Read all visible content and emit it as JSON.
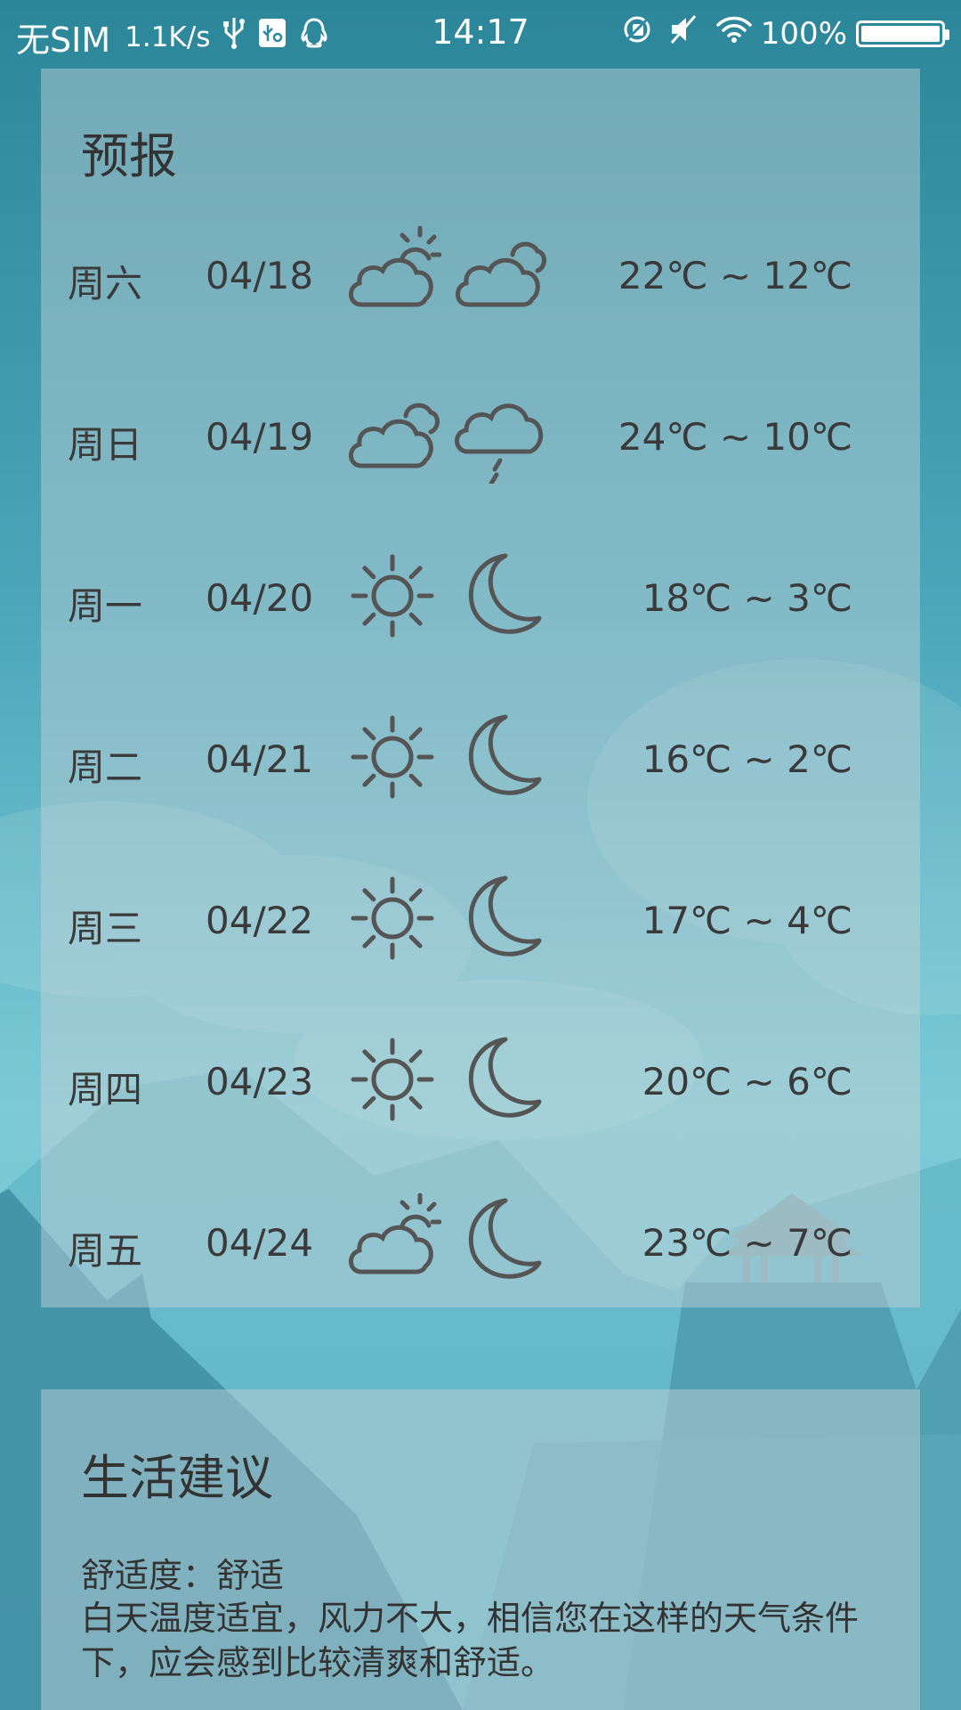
{
  "status_bar": {
    "carrier": "无SIM",
    "speed": "1.1K/s",
    "time": "14:17",
    "battery": "100%",
    "battery_level": 1.0,
    "icons": [
      "usb-icon",
      "usb-debug-icon",
      "qq-icon",
      "rotation-lock-icon",
      "mute-icon",
      "wifi-icon",
      "battery-icon"
    ]
  },
  "forecast": {
    "title": "预报",
    "days": [
      {
        "day": "周六",
        "date": "04/18",
        "icon_day": "partly-cloudy-icon",
        "icon_night": "cloudy-icon",
        "temp": "22℃ ~ 12℃"
      },
      {
        "day": "周日",
        "date": "04/19",
        "icon_day": "cloudy-icon",
        "icon_night": "light-rain-icon",
        "temp": "24℃ ~ 10℃"
      },
      {
        "day": "周一",
        "date": "04/20",
        "icon_day": "sunny-icon",
        "icon_night": "clear-night-icon",
        "temp": "18℃ ~ 3℃"
      },
      {
        "day": "周二",
        "date": "04/21",
        "icon_day": "sunny-icon",
        "icon_night": "clear-night-icon",
        "temp": "16℃ ~ 2℃"
      },
      {
        "day": "周三",
        "date": "04/22",
        "icon_day": "sunny-icon",
        "icon_night": "clear-night-icon",
        "temp": "17℃ ~ 4℃"
      },
      {
        "day": "周四",
        "date": "04/23",
        "icon_day": "sunny-icon",
        "icon_night": "clear-night-icon",
        "temp": "20℃ ~ 6℃"
      },
      {
        "day": "周五",
        "date": "04/24",
        "icon_day": "partly-cloudy-icon",
        "icon_night": "clear-night-icon",
        "temp": "23℃ ~ 7℃"
      }
    ]
  },
  "life": {
    "title": "生活建议",
    "comfort": "舒适度：舒适",
    "description": "白天温度适宜，风力不大，相信您在这样的天气条件下，应会感到比较清爽和舒适。"
  }
}
